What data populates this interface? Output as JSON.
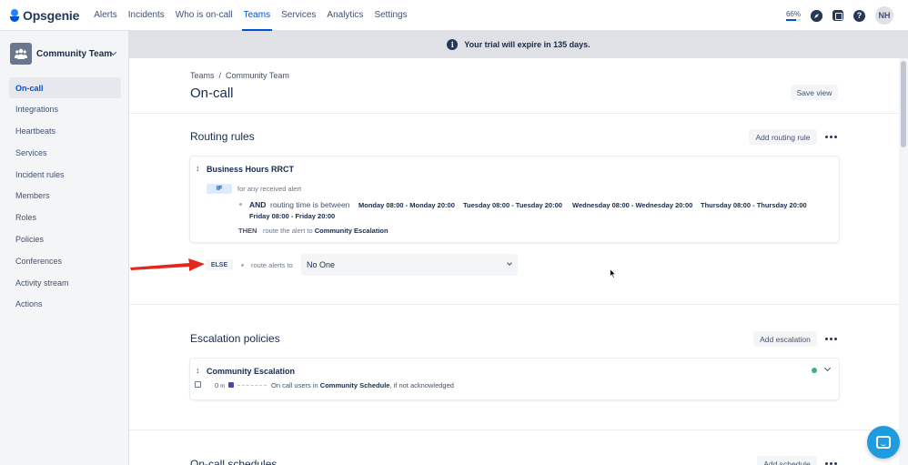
{
  "nav": {
    "logo": "Opsgenie",
    "items": [
      {
        "label": "Alerts",
        "active": false
      },
      {
        "label": "Incidents",
        "active": false
      },
      {
        "label": "Who is on-call",
        "active": false
      },
      {
        "label": "Teams",
        "active": true
      },
      {
        "label": "Services",
        "active": false
      },
      {
        "label": "Analytics",
        "active": false
      },
      {
        "label": "Settings",
        "active": false
      }
    ],
    "usage_percent": "66%",
    "usage_fraction": 0.66,
    "avatar_initials": "NH",
    "help_icon_glyph": "?",
    "accent_color": "#0052cc"
  },
  "sidebar": {
    "team_name": "Community Team",
    "items": [
      {
        "label": "On-call",
        "active": true
      },
      {
        "label": "Integrations",
        "active": false
      },
      {
        "label": "Heartbeats",
        "active": false
      },
      {
        "label": "Services",
        "active": false
      },
      {
        "label": "Incident rules",
        "active": false
      },
      {
        "label": "Members",
        "active": false
      },
      {
        "label": "Roles",
        "active": false
      },
      {
        "label": "Policies",
        "active": false
      },
      {
        "label": "Conferences",
        "active": false
      },
      {
        "label": "Activity stream",
        "active": false
      },
      {
        "label": "Actions",
        "active": false
      }
    ]
  },
  "banner": {
    "text": "Your trial will expire in 135 days.",
    "icon_glyph": "i"
  },
  "page": {
    "breadcrumb": [
      "Teams",
      "Community Team"
    ],
    "breadcrumb_separator": "/",
    "title": "On-call",
    "save_view_label": "Save view"
  },
  "routing": {
    "title": "Routing rules",
    "add_label": "Add routing rule",
    "rule": {
      "name": "Business Hours RRCT",
      "if_tag": "IF",
      "if_text": "for any received alert",
      "and_tag": "AND",
      "and_text": "routing time is between",
      "ranges": [
        "Monday 08:00 - Monday 20:00",
        "Tuesday 08:00 - Tuesday 20:00",
        "Wednesday 08:00 - Wednesday 20:00",
        "Thursday 08:00 - Thursday 20:00",
        "Friday 08:00 - Friday 20:00"
      ],
      "then_tag": "THEN",
      "then_text": "route the alert to",
      "then_target": "Community Escalation"
    },
    "else_tag": "ELSE",
    "else_text": "route alerts to",
    "else_value": "No One"
  },
  "escalation": {
    "title": "Escalation policies",
    "add_label": "Add escalation",
    "policy": {
      "name": "Community Escalation",
      "time": "0",
      "unit": "m",
      "text_pre": "On call users in",
      "schedule": "Community Schedule",
      "text_post": ", if not acknowledged",
      "status_color": "#36b37e"
    }
  },
  "schedules": {
    "title": "On-call schedules",
    "add_label": "Add schedule"
  },
  "annotation": {
    "arrow_color": "#e5261c"
  },
  "chat": {
    "color": "#1f9be0"
  }
}
